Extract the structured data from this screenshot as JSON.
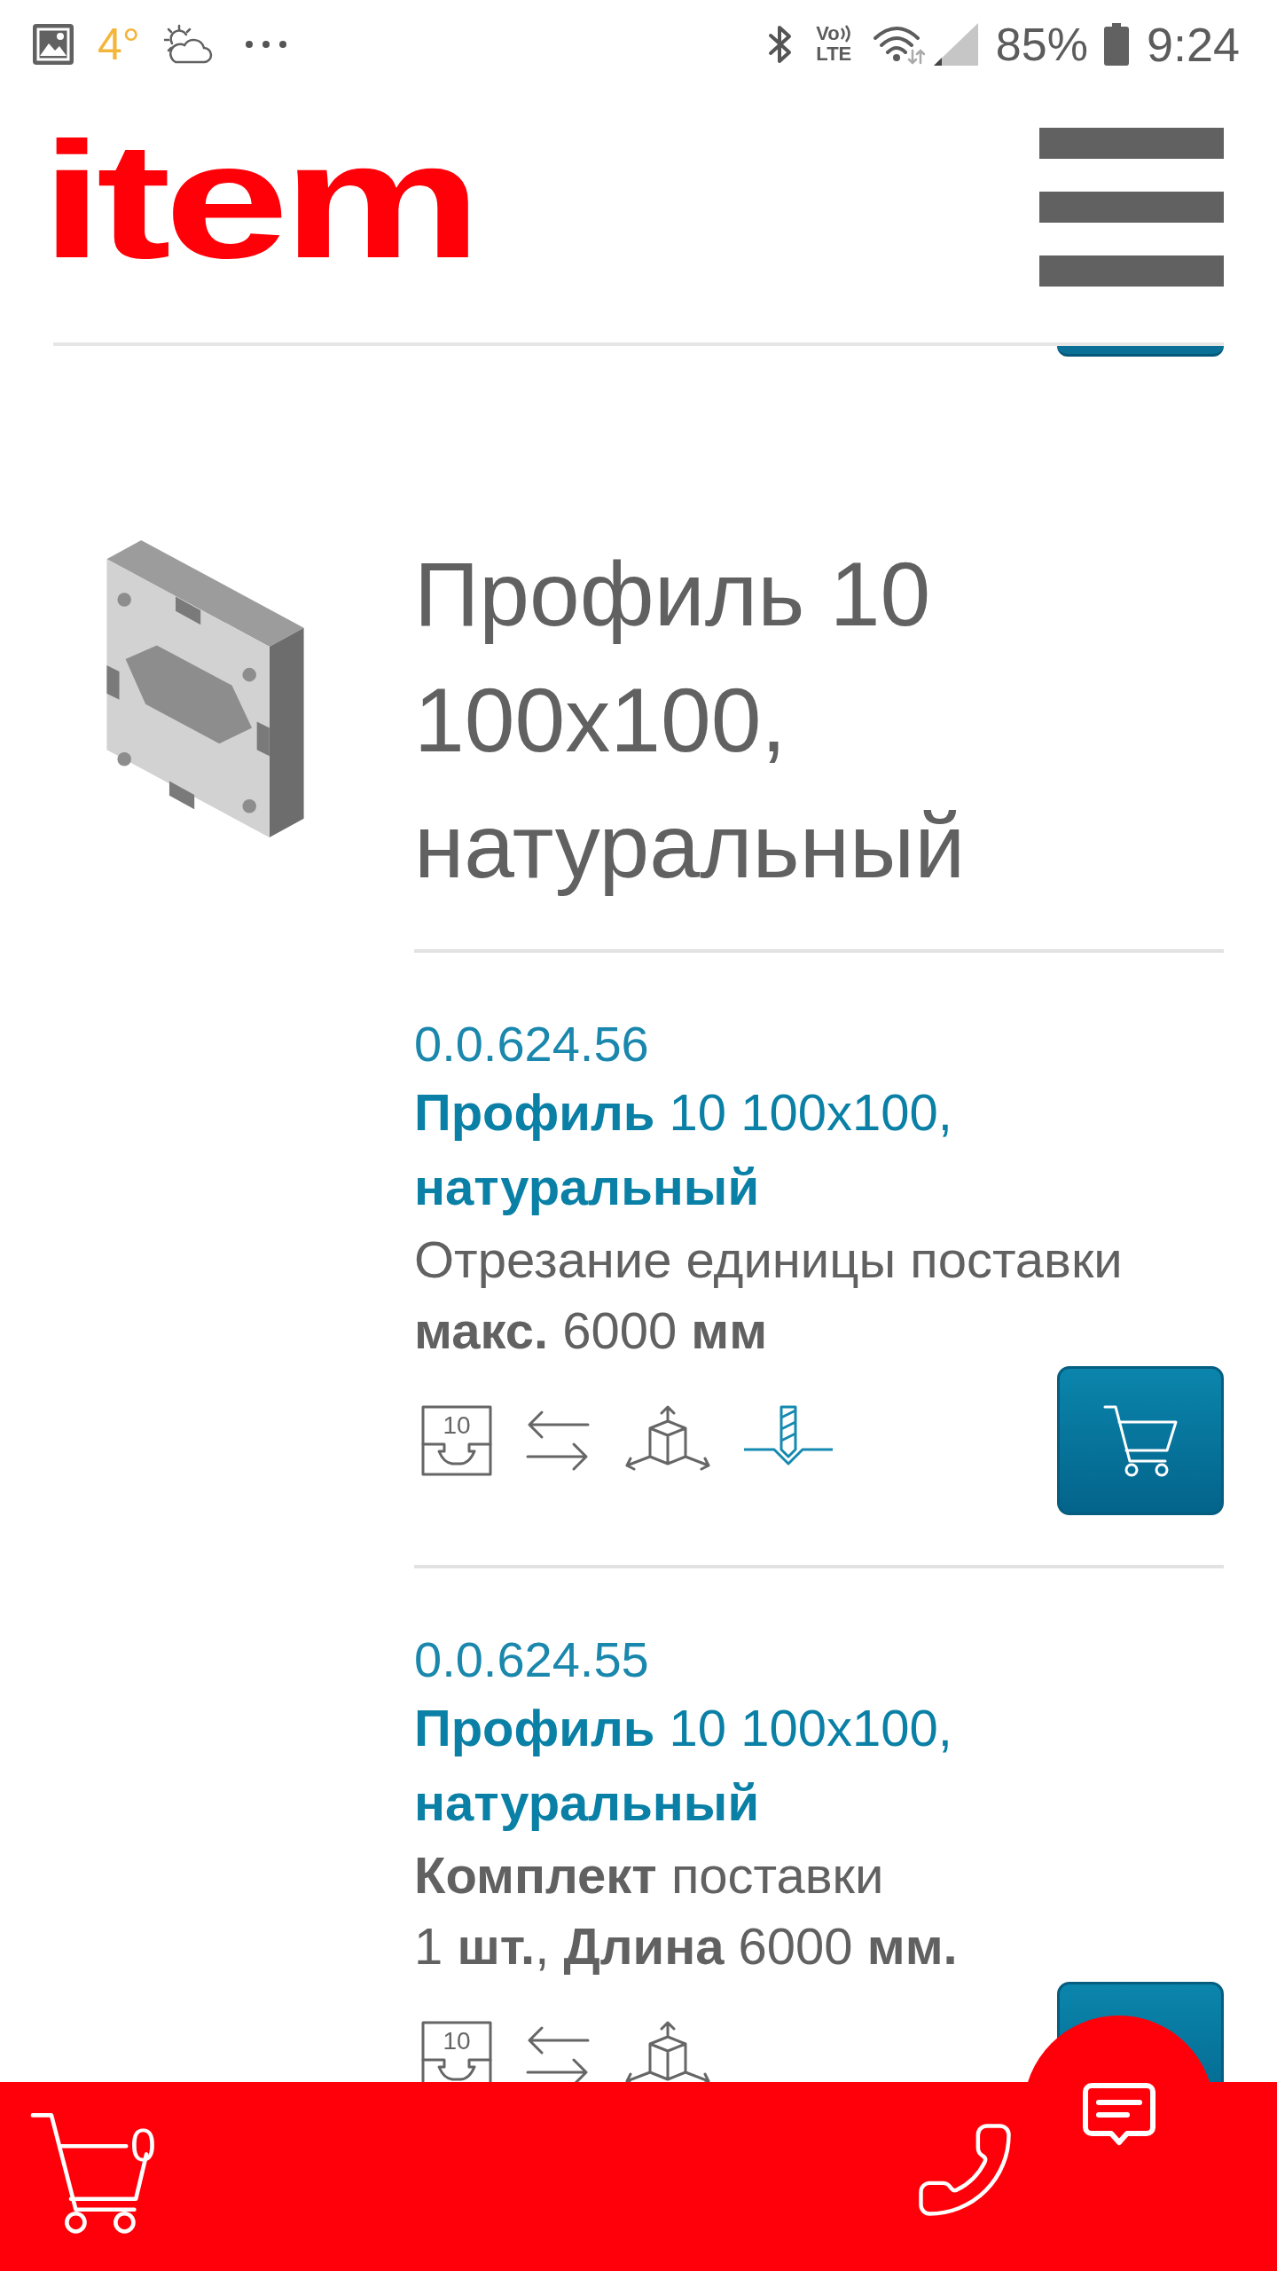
{
  "status_bar": {
    "temperature": "4°",
    "volte_top": "Vo",
    "volte_bottom": "LTE",
    "battery": "85%",
    "time": "9:24"
  },
  "header": {
    "logo": "item"
  },
  "product": {
    "title": "Профиль 10 100x100, натуральный"
  },
  "variants": [
    {
      "part_number": "0.0.624.56",
      "name": "**Профиль** 10 100x100, **натуральный**",
      "delivery_label": "Отрезание единицы поставки",
      "delivery_value": "**макс.** 6000 **мм**",
      "features": [
        {
          "kind": "series",
          "label": "10"
        },
        {
          "kind": "length"
        },
        {
          "kind": "dimensions"
        },
        {
          "kind": "machining"
        }
      ]
    },
    {
      "part_number": "0.0.624.55",
      "name": "**Профиль** 10 100x100, **натуральный**",
      "delivery_label": "**Комплект** поставки",
      "delivery_value": "1 **шт.**, **Длина** 6000 **мм.**",
      "features": [
        {
          "kind": "series",
          "label": "10"
        },
        {
          "kind": "length"
        },
        {
          "kind": "dimensions"
        }
      ]
    }
  ],
  "bottom_bar": {
    "cart_count": "0"
  }
}
